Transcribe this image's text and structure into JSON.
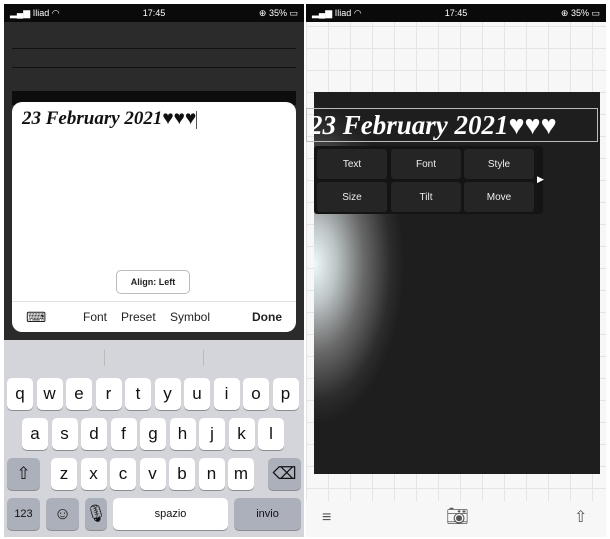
{
  "left": {
    "status": {
      "carrier": "Iliad",
      "time": "17:45",
      "battery": "35%"
    },
    "editor": {
      "text": "23 February 2021♥♥♥",
      "align_label": "Align: Left",
      "toolbar": {
        "font": "Font",
        "preset": "Preset",
        "symbol": "Symbol",
        "done": "Done"
      }
    },
    "keyboard": {
      "row1": [
        "q",
        "w",
        "e",
        "r",
        "t",
        "y",
        "u",
        "i",
        "o",
        "p"
      ],
      "row2": [
        "a",
        "s",
        "d",
        "f",
        "g",
        "h",
        "j",
        "k",
        "l"
      ],
      "row3": [
        "z",
        "x",
        "c",
        "v",
        "b",
        "n",
        "m"
      ],
      "numbers": "123",
      "space": "spazio",
      "return": "invio"
    }
  },
  "right": {
    "status": {
      "carrier": "Iliad",
      "time": "17:45",
      "battery": "35%"
    },
    "canvas_text": "23 February 2021♥♥♥",
    "menu": [
      "Text",
      "Font",
      "Style",
      "Size",
      "Tilt",
      "Move"
    ]
  }
}
